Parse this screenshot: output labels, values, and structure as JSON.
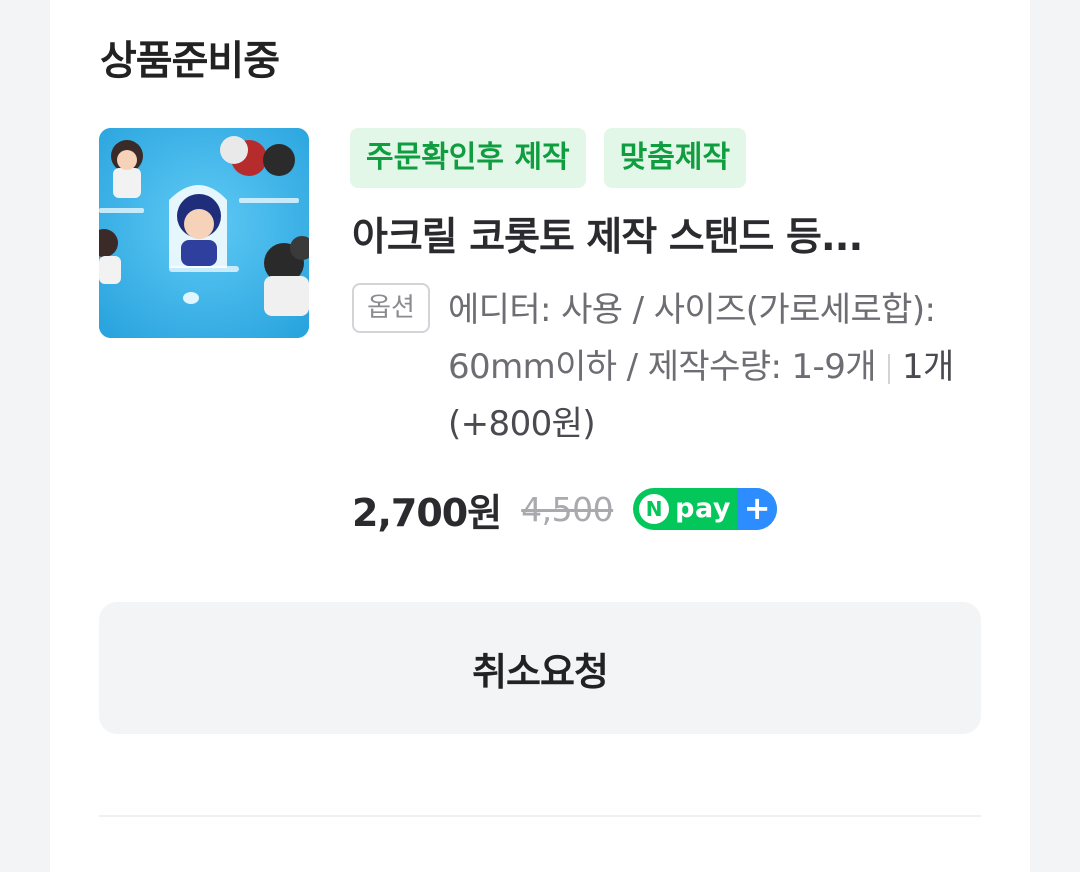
{
  "order": {
    "status": "상품준비중",
    "badges": [
      "주문확인후 제작",
      "맞춤제작"
    ],
    "product_title": "아크릴 코롯토 제작 스탠드 등...",
    "option_tag": "옵션",
    "option_text": "에디터: 사용 / 사이즈(가로세로합): 60mm이하 / 제작수량: 1-9개",
    "option_quantity": "1개 (+800원)",
    "price": "2,700원",
    "original_price": "4,500",
    "npay": {
      "circle_label": "N",
      "label": "pay",
      "plus": "+"
    },
    "cancel_label": "취소요청"
  },
  "colors": {
    "badge_bg": "#e3f7e9",
    "badge_text": "#0f9d3f",
    "npay_green": "#03c75a",
    "npay_blue": "#2d8cff"
  }
}
